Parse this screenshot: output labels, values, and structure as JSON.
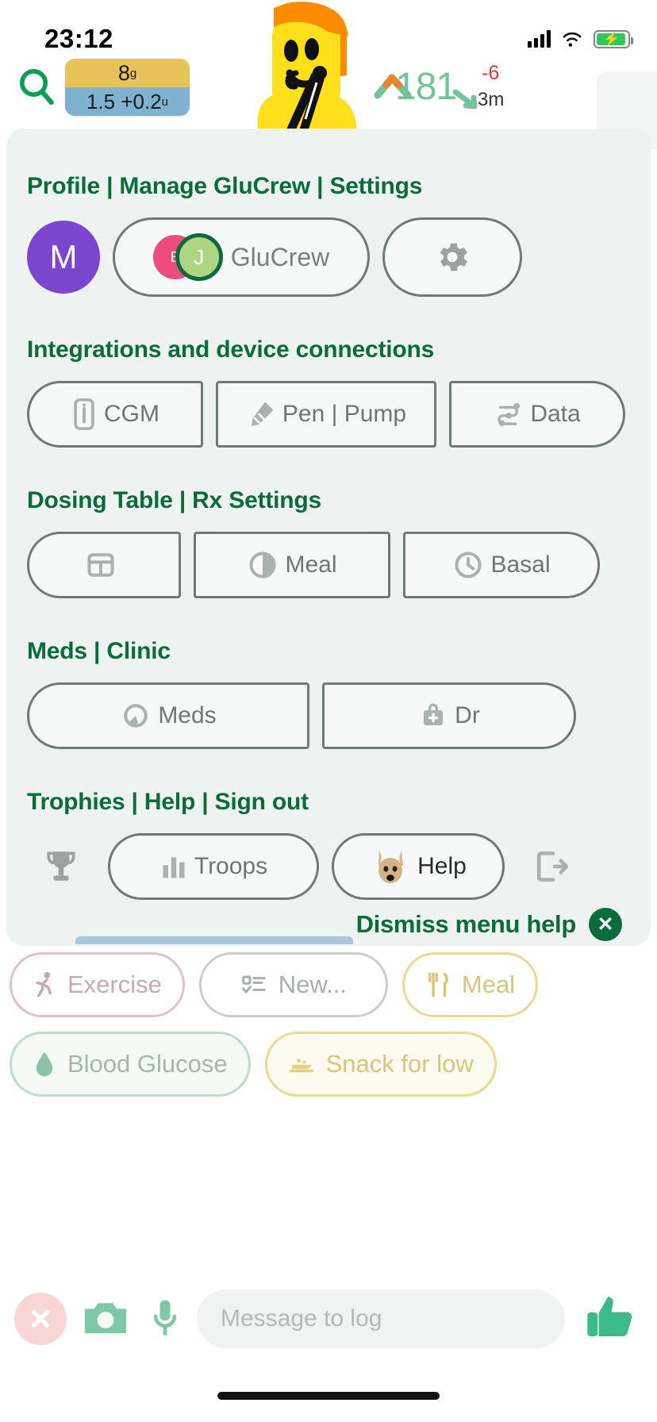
{
  "statusbar": {
    "time": "23:12",
    "battery_icon": "battery-charging-icon",
    "wifi_icon": "wifi-icon",
    "signal_icon": "cellular-signal-icon"
  },
  "appbar": {
    "search_icon": "search-icon",
    "dose": {
      "carbs_value": "8",
      "carbs_unit": "g",
      "insulin_value": "1.5 +0.2",
      "insulin_unit": "u"
    },
    "glucose": {
      "value": "181",
      "delta": "-6",
      "ago": "3m",
      "trend_up_icon": "trend-up-icon",
      "trend_down_icon": "trend-down-icon",
      "color": "#73c39a",
      "delta_color": "#e03b3b"
    },
    "overflow_icon": "kebab-menu-icon"
  },
  "menu": {
    "sections": [
      {
        "title": "Profile | Manage GluCrew | Settings",
        "items": [
          {
            "label": "M",
            "name": "profile-avatar",
            "icon": "avatar"
          },
          {
            "label": "GluCrew",
            "name": "glucrew-button",
            "icon": "crew-avatars",
            "crew": [
              {
                "initial": "E",
                "color": "#ec4d7c"
              },
              {
                "initial": "J",
                "color": "#aed581"
              }
            ]
          },
          {
            "label": "",
            "name": "settings-button",
            "icon": "gear-icon"
          }
        ]
      },
      {
        "title": "Integrations and device connections",
        "items": [
          {
            "label": "CGM",
            "name": "cgm-button",
            "icon": "cgm-sensor-icon"
          },
          {
            "label": "Pen | Pump",
            "name": "pen-pump-button",
            "icon": "syringe-icon"
          },
          {
            "label": "Data",
            "name": "data-button",
            "icon": "data-nodes-icon"
          }
        ]
      },
      {
        "title": "Dosing Table | Rx Settings",
        "items": [
          {
            "label": "",
            "name": "dosing-table-button",
            "icon": "table-grid-icon"
          },
          {
            "label": "Meal",
            "name": "meal-dosing-button",
            "icon": "pie-chart-icon"
          },
          {
            "label": "Basal",
            "name": "basal-dosing-button",
            "icon": "clock-icon"
          }
        ]
      },
      {
        "title": "Meds | Clinic",
        "items": [
          {
            "label": "Meds",
            "name": "meds-button",
            "icon": "pill-icon"
          },
          {
            "label": "Dr",
            "name": "doctor-button",
            "icon": "medical-bag-icon"
          }
        ]
      },
      {
        "title": "Trophies | Help | Sign out",
        "items": [
          {
            "label": "",
            "name": "trophies-button",
            "icon": "trophy-icon"
          },
          {
            "label": "Troops",
            "name": "troops-button",
            "icon": "bar-chart-icon"
          },
          {
            "label": "Help",
            "name": "help-button",
            "icon": "kangaroo-icon"
          },
          {
            "label": "",
            "name": "sign-out-button",
            "icon": "sign-out-icon"
          }
        ]
      }
    ],
    "dismiss": {
      "label": "Dismiss menu help",
      "close_icon": "close-circle-icon",
      "color": "#0a6b3b"
    }
  },
  "quick_chips": {
    "row1": [
      {
        "label": "Exercise",
        "name": "chip-exercise",
        "icon": "running-icon",
        "color": "#e0c0cd"
      },
      {
        "label": "New...",
        "name": "chip-new",
        "icon": "checklist-icon",
        "color": "#c9cdcb"
      },
      {
        "label": "Meal",
        "name": "chip-meal",
        "icon": "cutlery-icon",
        "color": "#ecd78e"
      }
    ],
    "row2": [
      {
        "label": "Blood Glucose",
        "name": "chip-blood-glucose",
        "icon": "blood-drop-icon",
        "color": "#bedcc9"
      },
      {
        "label": "Snack for low",
        "name": "chip-snack-for-low",
        "icon": "snack-icon",
        "color": "#ecd78e"
      }
    ]
  },
  "composer": {
    "cancel_icon": "close-icon",
    "camera_icon": "camera-icon",
    "mic_icon": "microphone-icon",
    "input_placeholder": "Message to log",
    "input_value": "",
    "send_icon": "thumbs-up-icon"
  }
}
